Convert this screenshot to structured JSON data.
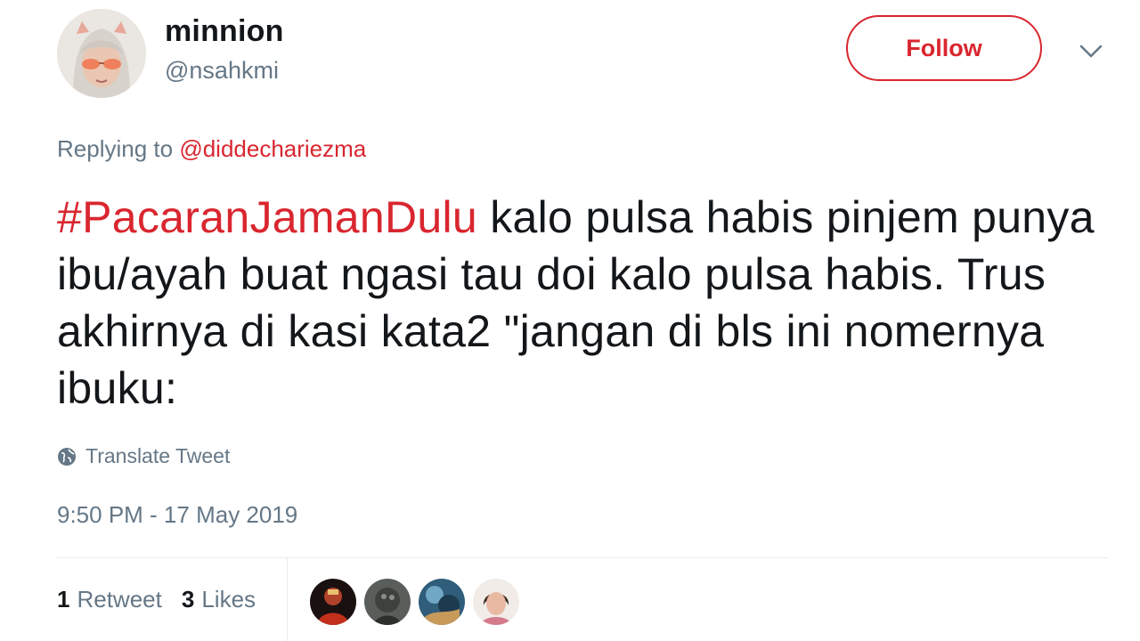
{
  "author": {
    "display_name": "minnion",
    "handle": "@nsahkmi",
    "avatar_icon": "user-avatar"
  },
  "follow_button": {
    "label": "Follow"
  },
  "menu": {
    "icon": "chevron-down-icon"
  },
  "reply": {
    "prefix": "Replying to",
    "mention": "@diddechariezma"
  },
  "tweet": {
    "hashtag": "#PacaranJamanDulu",
    "body": " kalo pulsa habis pinjem punya ibu/ayah buat ngasi tau doi kalo pulsa habis. Trus akhirnya di kasi kata2 \"jangan di bls ini nomernya ibuku:"
  },
  "translate": {
    "label": "Translate Tweet",
    "icon": "globe-icon"
  },
  "timestamp": "9:50 PM - 17 May 2019",
  "stats": {
    "retweet_count": "1",
    "retweet_label": "Retweet",
    "like_count": "3",
    "like_label": "Likes"
  },
  "colors": {
    "accent": "#d9262f",
    "secondary_text": "#657786",
    "primary_text": "#14171a",
    "divider": "#e6ecf0"
  }
}
